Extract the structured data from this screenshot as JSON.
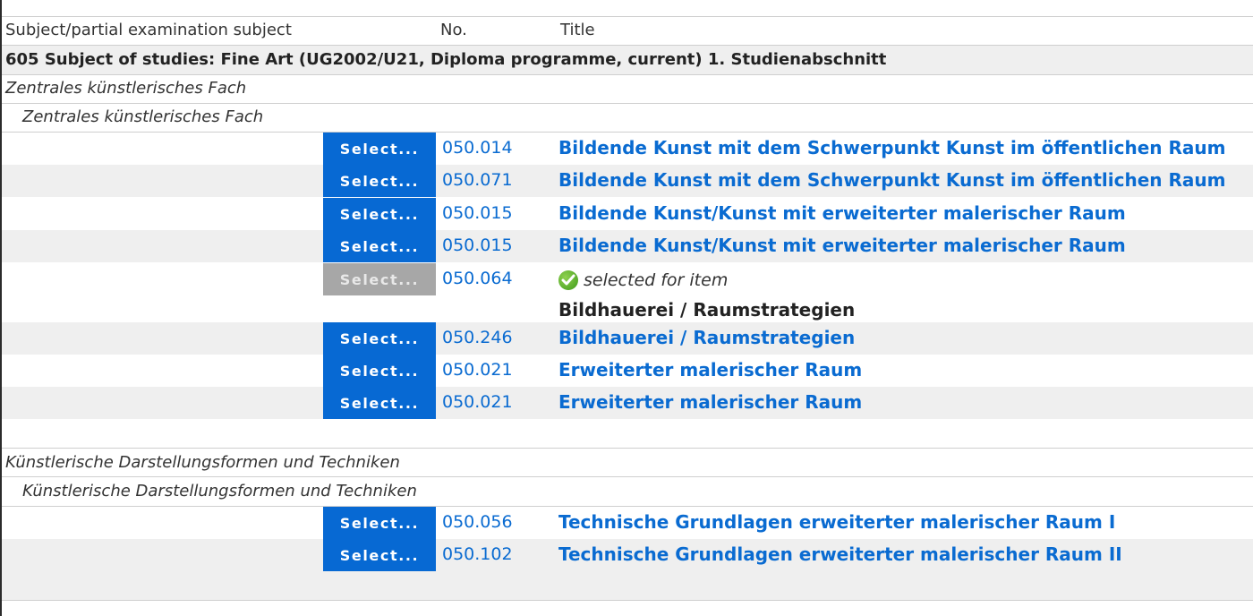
{
  "header": {
    "subject_label": "Subject/partial examination subject",
    "no_label": "No.",
    "title_label": "Title"
  },
  "section": {
    "title": "605 Subject of studies: Fine Art (UG2002/U21, Diploma programme, current) 1. Studienabschnitt"
  },
  "group1": {
    "label": "Zentrales künstlerisches Fach",
    "sublabel": "Zentrales künstlerisches Fach",
    "courses": [
      {
        "button": "Select...",
        "number": "050.014",
        "title": "Bildende Kunst mit dem Schwerpunkt Kunst im öffentlichen Raum"
      },
      {
        "button": "Select...",
        "number": "050.071",
        "title": "Bildende Kunst mit dem Schwerpunkt Kunst im öffentlichen Raum"
      },
      {
        "button": "Select...",
        "number": "050.015",
        "title": "Bildende Kunst/Kunst mit erweiterter malerischer Raum"
      },
      {
        "button": "Select...",
        "number": "050.015",
        "title": "Bildende Kunst/Kunst mit erweiterter malerischer Raum"
      },
      {
        "button": "Select...",
        "number": "050.064",
        "status": "selected for item",
        "title": "Bildhauerei / Raumstrategien",
        "disabled": true
      },
      {
        "button": "Select...",
        "number": "050.246",
        "title": "Bildhauerei / Raumstrategien"
      },
      {
        "button": "Select...",
        "number": "050.021",
        "title": "Erweiterter malerischer Raum"
      },
      {
        "button": "Select...",
        "number": "050.021",
        "title": "Erweiterter malerischer Raum"
      }
    ]
  },
  "group2": {
    "label": "Künstlerische Darstellungsformen und Techniken",
    "sublabel": "Künstlerische Darstellungsformen und Techniken",
    "courses": [
      {
        "button": "Select...",
        "number": "050.056",
        "title": "Technische Grundlagen erweiterter malerischer Raum I"
      },
      {
        "button": "Select...",
        "number": "050.102",
        "title": "Technische Grundlagen erweiterter malerischer Raum II"
      }
    ]
  },
  "colors": {
    "button": "#0769d3",
    "button_disabled": "#a7a7a7",
    "link": "#0a6bd1",
    "row_alt": "#efefef"
  },
  "icons": {
    "selected": "check-circle-icon"
  }
}
